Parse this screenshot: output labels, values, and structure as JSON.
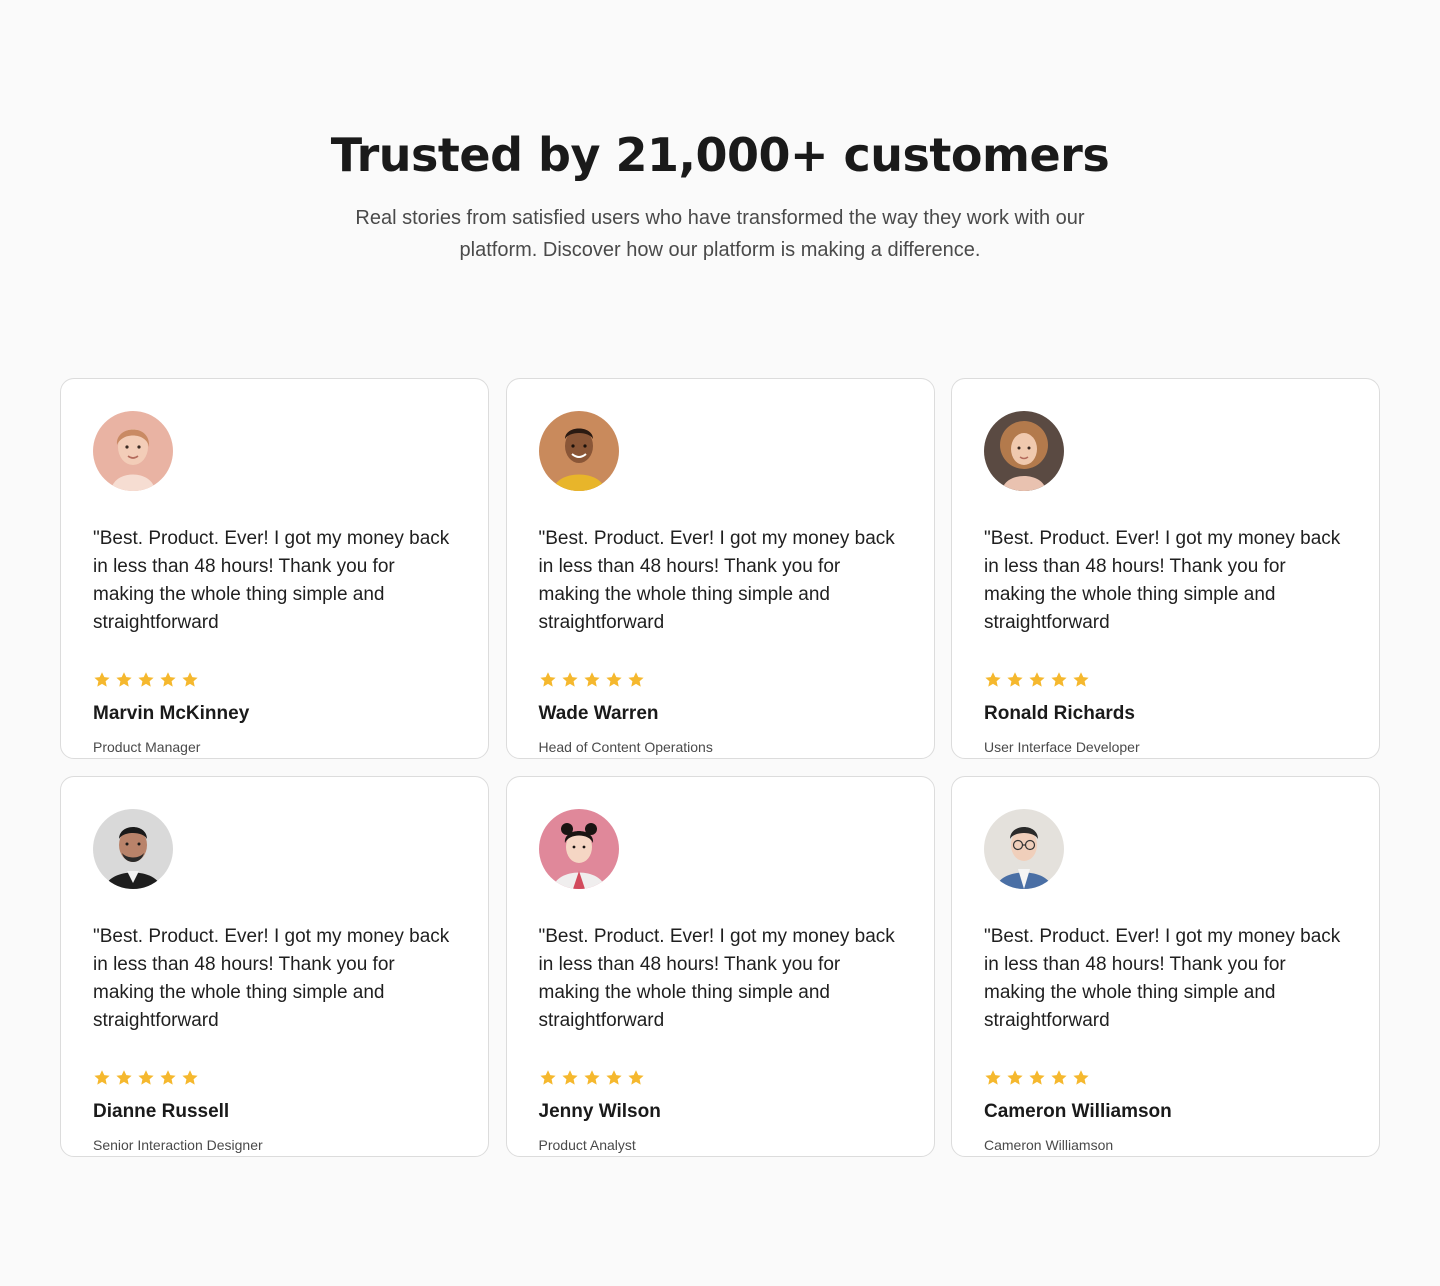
{
  "header": {
    "title": "Trusted by 21,000+ customers",
    "subtitle": "Real stories from satisfied users who have transformed the way they work with our platform. Discover how our platform is making a difference."
  },
  "colors": {
    "star": "#f5b82e",
    "card_border": "#dcdcdc",
    "background": "#fafafa"
  },
  "testimonials": [
    {
      "quote": "\"Best. Product. Ever! I got my money back in less than 48 hours! Thank you for making the whole thing simple and straightforward",
      "rating": 5,
      "name": "Marvin McKinney",
      "role": "Product Manager",
      "avatar_bg": "#e9b3a3"
    },
    {
      "quote": "\"Best. Product. Ever! I got my money back in less than 48 hours! Thank you for making the whole thing simple and straightforward",
      "rating": 5,
      "name": "Wade Warren",
      "role": "Head of Content Operations",
      "avatar_bg": "#c98a5c"
    },
    {
      "quote": "\"Best. Product. Ever! I got my money back in less than 48 hours! Thank you for making the whole thing simple and straightforward",
      "rating": 5,
      "name": "Ronald Richards",
      "role": "User Interface Developer",
      "avatar_bg": "#5a4a42"
    },
    {
      "quote": "\"Best. Product. Ever! I got my money back in less than 48 hours! Thank you for making the whole thing simple and straightforward",
      "rating": 5,
      "name": "Dianne Russell",
      "role": "Senior Interaction Designer",
      "avatar_bg": "#d9d9d9"
    },
    {
      "quote": "\"Best. Product. Ever! I got my money back in less than 48 hours! Thank you for making the whole thing simple and straightforward",
      "rating": 5,
      "name": "Jenny Wilson",
      "role": "Product Analyst",
      "avatar_bg": "#e0889a"
    },
    {
      "quote": "\"Best. Product. Ever! I got my money back in less than 48 hours! Thank you for making the whole thing simple and straightforward",
      "rating": 5,
      "name": "Cameron Williamson",
      "role": "Cameron Williamson",
      "avatar_bg": "#e4e1dc"
    }
  ]
}
